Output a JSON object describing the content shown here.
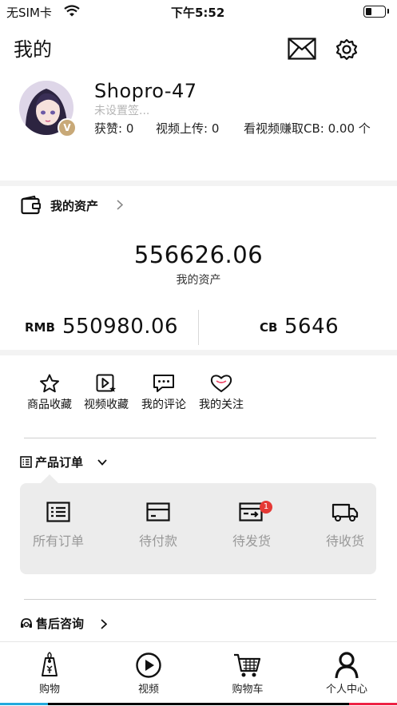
{
  "status_bar": {
    "carrier": "无SIM卡",
    "time": "下午5:52"
  },
  "header": {
    "title": "我的",
    "mail_icon": "mail-icon",
    "settings_icon": "gear-icon"
  },
  "profile": {
    "username": "Shopro-47",
    "signature_placeholder": "未设置签...",
    "vip_badge": "V",
    "stats": {
      "likes_label": "获赞: 0",
      "uploads_label": "视频上传: 0",
      "earn_label": "看视频赚取CB: 0.00 个"
    }
  },
  "assets": {
    "section_title": "我的资产",
    "total_value": "556626.06",
    "total_caption": "我的资产",
    "rmb_label": "RMB",
    "rmb_value": "550980.06",
    "cb_label": "CB",
    "cb_value": "5646"
  },
  "quick_actions": [
    {
      "label": "商品收藏",
      "icon": "star-icon"
    },
    {
      "label": "视频收藏",
      "icon": "video-favorite-icon"
    },
    {
      "label": "我的评论",
      "icon": "comment-icon"
    },
    {
      "label": "我的关注",
      "icon": "heart-icon"
    }
  ],
  "orders": {
    "section_title": "产品订单",
    "items": [
      {
        "label": "所有订单",
        "icon": "order-list-icon"
      },
      {
        "label": "待付款",
        "icon": "card-icon"
      },
      {
        "label": "待发货",
        "icon": "shipping-box-icon",
        "badge": "1"
      },
      {
        "label": "待收货",
        "icon": "truck-icon"
      }
    ]
  },
  "after_sales": {
    "section_title": "售后咨询"
  },
  "tab_bar": {
    "items": [
      {
        "label": "购物",
        "icon": "shopping-tag-icon"
      },
      {
        "label": "视频",
        "icon": "play-icon"
      },
      {
        "label": "购物车",
        "icon": "cart-icon"
      },
      {
        "label": "个人中心",
        "icon": "person-icon"
      }
    ]
  }
}
